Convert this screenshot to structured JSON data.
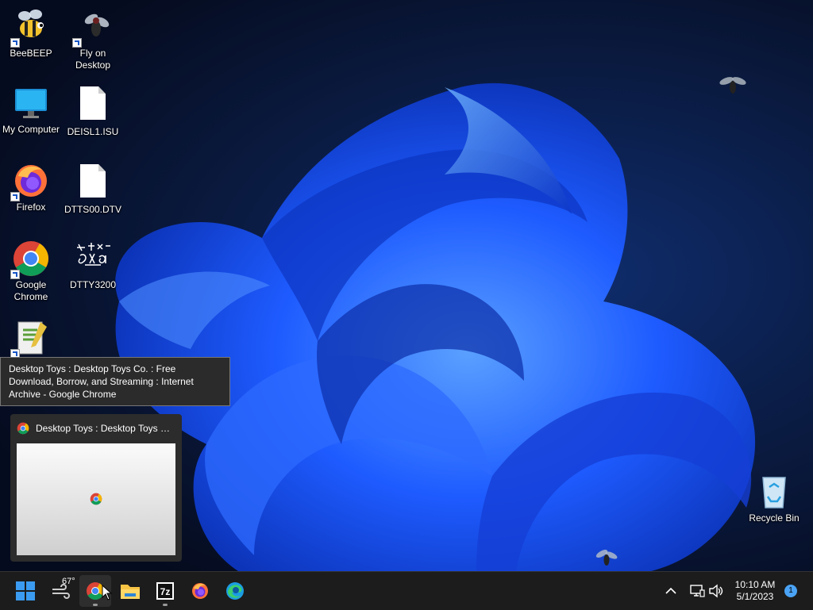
{
  "desktop": {
    "icons": [
      {
        "label": "BeeBEEP",
        "icon": "bee-icon"
      },
      {
        "label": "Fly on Desktop",
        "icon": "fly-icon"
      },
      {
        "label": "My Computer",
        "icon": "monitor-icon"
      },
      {
        "label": "DEISL1.ISU",
        "icon": "file-icon"
      },
      {
        "label": "Firefox",
        "icon": "firefox-icon"
      },
      {
        "label": "DTTS00.DTV",
        "icon": "file-icon"
      },
      {
        "label": "Google Chrome",
        "icon": "chrome-icon"
      },
      {
        "label": "DTTY3200",
        "icon": "desktop-toys-icon"
      },
      {
        "label": "Recycle Bin",
        "icon": "recycle-bin-icon"
      }
    ]
  },
  "tooltip": {
    "text": "Desktop Toys : Desktop Toys Co. : Free Download, Borrow, and Streaming : Internet Archive - Google Chrome"
  },
  "preview": {
    "title": "Desktop Toys : Desktop Toys Co..."
  },
  "taskbar": {
    "weather_temp": "67°",
    "apps": [
      "start",
      "weather",
      "google-chrome",
      "file-explorer",
      "7-zip",
      "firefox",
      "edge"
    ]
  },
  "tray": {
    "time": "10:10 AM",
    "date": "5/1/2023",
    "notification_count": "1"
  },
  "colors": {
    "wallpaper_bloom": "#1a4cff",
    "taskbar": "#1c1c1c",
    "accent": "#1a73e8"
  }
}
